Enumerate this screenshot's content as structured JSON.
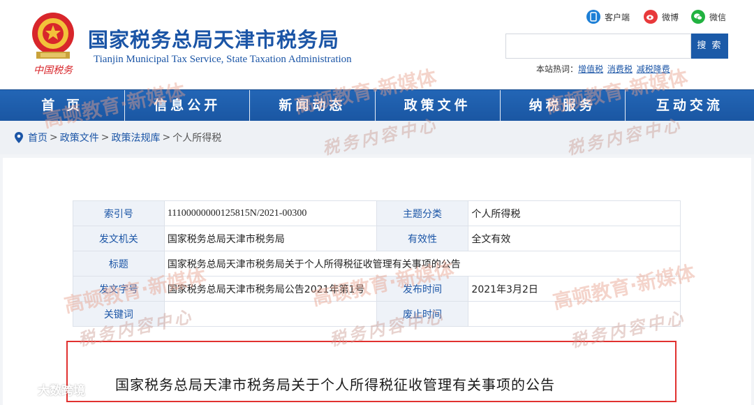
{
  "header": {
    "site_title": "国家税务总局天津市税务局",
    "site_subtitle": "Tianjin Municipal Tax Service, State Taxation Administration",
    "emblem_caption": "中国税务",
    "social": {
      "client": "客户端",
      "weibo": "微博",
      "wechat": "微信"
    },
    "search": {
      "placeholder": "",
      "button": "搜 索"
    },
    "hot_words": {
      "label": "本站热词：",
      "items": [
        "增值税",
        "消费税",
        "减税降费"
      ]
    }
  },
  "nav": {
    "items": [
      "首 页",
      "信息公开",
      "新闻动态",
      "政策文件",
      "纳税服务",
      "互动交流"
    ]
  },
  "breadcrumb": {
    "items": [
      "首页",
      "政策文件",
      "政策法规库"
    ],
    "current": "个人所得税",
    "separator": ">"
  },
  "meta": {
    "index_label": "索引号",
    "index_value": "11100000000125815N/2021-00300",
    "topic_label": "主题分类",
    "topic_value": "个人所得税",
    "issuer_label": "发文机关",
    "issuer_value": "国家税务总局天津市税务局",
    "validity_label": "有效性",
    "validity_value": "全文有效",
    "title_label": "标题",
    "title_value": "国家税务总局天津市税务局关于个人所得税征收管理有关事项的公告",
    "docno_label": "发文字号",
    "docno_value": "国家税务总局天津市税务局公告2021年第1号",
    "pubdate_label": "发布时间",
    "pubdate_value": "2021年3月2日",
    "keywords_label": "关键词",
    "keywords_value": "",
    "repeal_label": "废止时间",
    "repeal_value": ""
  },
  "document": {
    "title": "国家税务总局天津市税务局关于个人所得税征收管理有关事项的公告"
  },
  "watermark": {
    "brand": "高顿教育·新媒体",
    "center": "税务内容中心",
    "corner": "大数跨境"
  },
  "colors": {
    "brand_blue": "#1b55a6",
    "nav_blue": "#1d5cab",
    "highlight_red": "#e1312f"
  }
}
